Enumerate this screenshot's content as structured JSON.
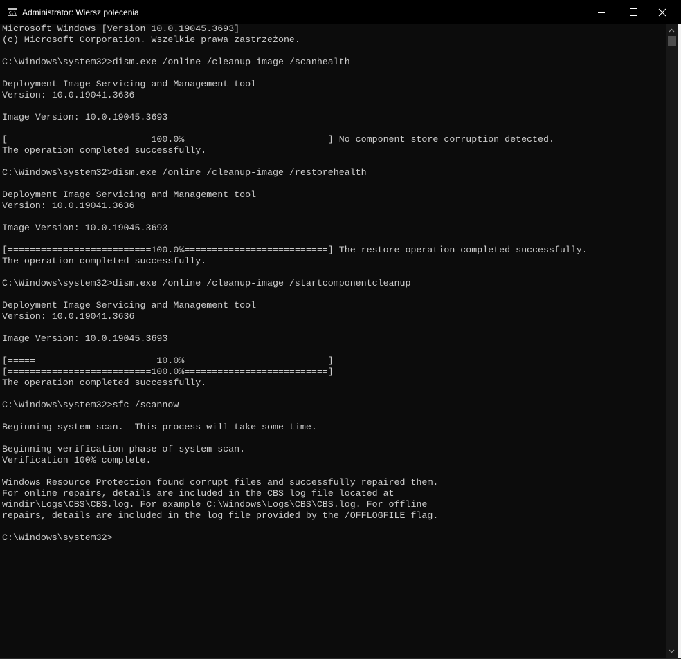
{
  "window": {
    "title": "Administrator: Wiersz polecenia",
    "icon": "cmd-icon",
    "controls": {
      "minimize": "minimize-icon",
      "maximize": "maximize-icon",
      "close": "close-icon"
    }
  },
  "console": {
    "background": "#0c0c0c",
    "foreground": "#cccccc",
    "lines": [
      "Microsoft Windows [Version 10.0.19045.3693]",
      "(c) Microsoft Corporation. Wszelkie prawa zastrzeżone.",
      "",
      "C:\\Windows\\system32>dism.exe /online /cleanup-image /scanhealth",
      "",
      "Deployment Image Servicing and Management tool",
      "Version: 10.0.19041.3636",
      "",
      "Image Version: 10.0.19045.3693",
      "",
      "[==========================100.0%==========================] No component store corruption detected.",
      "The operation completed successfully.",
      "",
      "C:\\Windows\\system32>dism.exe /online /cleanup-image /restorehealth",
      "",
      "Deployment Image Servicing and Management tool",
      "Version: 10.0.19041.3636",
      "",
      "Image Version: 10.0.19045.3693",
      "",
      "[==========================100.0%==========================] The restore operation completed successfully.",
      "The operation completed successfully.",
      "",
      "C:\\Windows\\system32>dism.exe /online /cleanup-image /startcomponentcleanup",
      "",
      "Deployment Image Servicing and Management tool",
      "Version: 10.0.19041.3636",
      "",
      "Image Version: 10.0.19045.3693",
      "",
      "[=====                      10.0%                          ]",
      "[==========================100.0%==========================]",
      "The operation completed successfully.",
      "",
      "C:\\Windows\\system32>sfc /scannow",
      "",
      "Beginning system scan.  This process will take some time.",
      "",
      "Beginning verification phase of system scan.",
      "Verification 100% complete.",
      "",
      "Windows Resource Protection found corrupt files and successfully repaired them.",
      "For online repairs, details are included in the CBS log file located at",
      "windir\\Logs\\CBS\\CBS.log. For example C:\\Windows\\Logs\\CBS\\CBS.log. For offline",
      "repairs, details are included in the log file provided by the /OFFLOGFILE flag.",
      "",
      "C:\\Windows\\system32>"
    ]
  },
  "scrollbar": {
    "up": "scroll-up-arrow-icon",
    "down": "scroll-down-arrow-icon"
  }
}
